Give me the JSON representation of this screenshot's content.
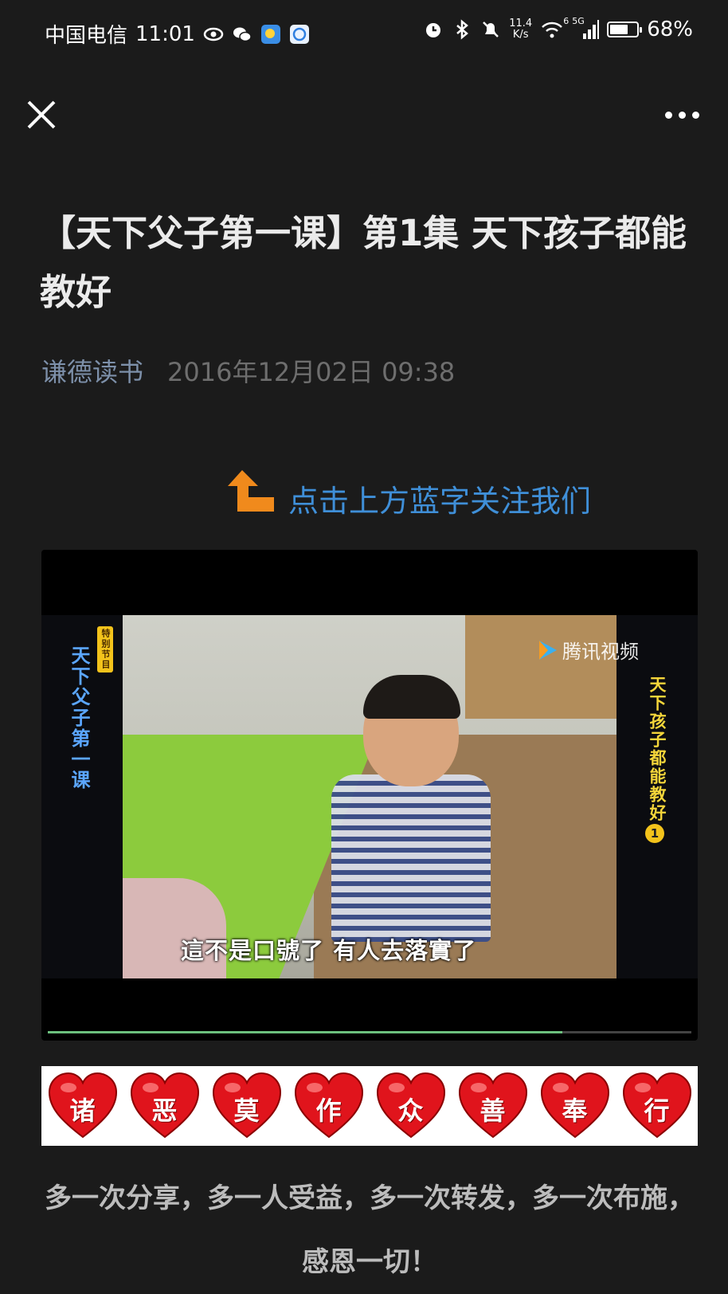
{
  "status_bar": {
    "carrier": "中国电信",
    "time": "11:01",
    "net_speed_value": "11.4",
    "net_speed_unit": "K/s",
    "signal_label": "5G",
    "wifi_badge": "6",
    "battery_percent": "68%",
    "battery_level": 0.68
  },
  "article": {
    "title": "【天下父子第一课】第1集 天下孩子都能教好",
    "author": "谦德读书",
    "date": "2016年12月02日 09:38",
    "follow_prompt": "点击上方蓝字关注我们"
  },
  "video": {
    "series_badge": "特别节目",
    "series_title": "天下父子第一课",
    "episode_title": "天下孩子都能教好",
    "episode_number": "1",
    "platform_logo": "腾讯视频",
    "subtitle": "這不是口號了 有人去落實了",
    "progress": 0.8
  },
  "banner": {
    "characters": [
      "诸",
      "恶",
      "莫",
      "作",
      "众",
      "善",
      "奉",
      "行"
    ],
    "heart_color": "#e0141c"
  },
  "footer": {
    "text": "多一次分享，多一人受益，多一次转发，多一次布施，感恩一切！"
  },
  "colors": {
    "background": "#1b1b1b",
    "author_link": "#7d90aa",
    "follow_link": "#3f8fd8"
  }
}
